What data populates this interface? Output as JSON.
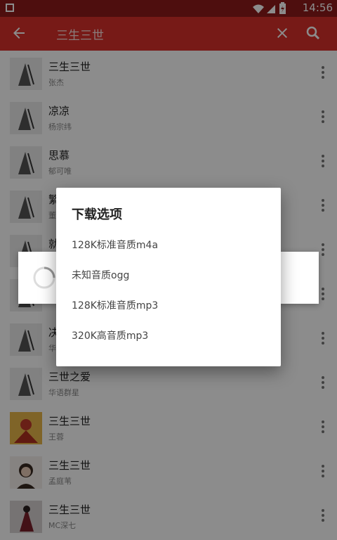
{
  "status_bar": {
    "time": "14:56"
  },
  "toolbar": {
    "query": "三生三世"
  },
  "songs": [
    {
      "title": "三生三世",
      "artist": "张杰"
    },
    {
      "title": "凉凉",
      "artist": "杨宗纬"
    },
    {
      "title": "思慕",
      "artist": "郁可唯"
    },
    {
      "title": "繁",
      "artist": "董"
    },
    {
      "title": "就",
      "artist": ""
    },
    {
      "title": "",
      "artist": ""
    },
    {
      "title": "决",
      "artist": "华"
    },
    {
      "title": "三世之爱",
      "artist": "华语群星"
    },
    {
      "title": "三生三世",
      "artist": "王蓉"
    },
    {
      "title": "三生三世",
      "artist": "孟庭苇"
    },
    {
      "title": "三生三世",
      "artist": "MC深七"
    }
  ],
  "dialog": {
    "title": "下载选项",
    "options": [
      "128K标准音质m4a",
      "未知音质ogg",
      "128K标准音质mp3",
      "320K高音质mp3"
    ]
  }
}
